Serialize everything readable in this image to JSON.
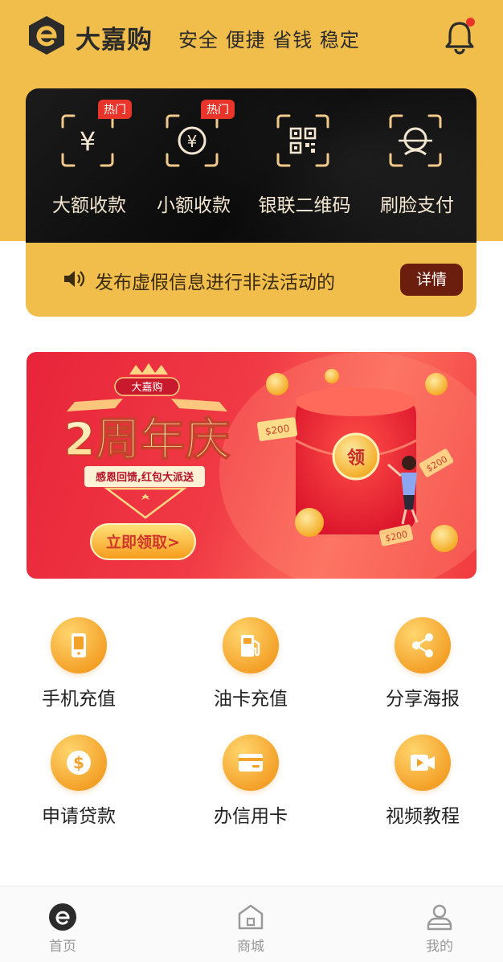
{
  "header": {
    "brand": "大嘉购",
    "slogan": "安全 便捷 省钱 稳定",
    "notification_icon": "bell-icon"
  },
  "colors": {
    "primary_yellow": "#f2be4b",
    "dark_card": "#111111",
    "hot_badge": "#e8352b",
    "detail_button": "#6b1d0e",
    "icon_orange": "#f4a22a"
  },
  "payments": [
    {
      "label": "大额收款",
      "badge": "热门",
      "icon": "yuan-scan-icon"
    },
    {
      "label": "小额收款",
      "badge": "热门",
      "icon": "yuan-coin-scan-icon"
    },
    {
      "label": "银联二维码",
      "badge": "",
      "icon": "qr-code-scan-icon"
    },
    {
      "label": "刷脸支付",
      "badge": "",
      "icon": "face-scan-icon"
    }
  ],
  "notice": {
    "icon": "speaker-icon",
    "text": "发布虚假信息进行非法活动的",
    "detail_label": "详情"
  },
  "banner": {
    "brand_tag": "大嘉购",
    "title": "2周年庆",
    "subtitle": "感恩回馈,红包大派送",
    "button": "立即领取>",
    "envelope_char": "领",
    "coin_amount": "$200",
    "coin_amount_2": "$200",
    "coin_amount_3": "$200"
  },
  "services": [
    {
      "label": "手机充值",
      "icon": "phone-icon"
    },
    {
      "label": "油卡充值",
      "icon": "fuel-pump-icon"
    },
    {
      "label": "分享海报",
      "icon": "share-icon"
    },
    {
      "label": "申请贷款",
      "icon": "dollar-coin-icon"
    },
    {
      "label": "办信用卡",
      "icon": "credit-card-icon"
    },
    {
      "label": "视频教程",
      "icon": "video-play-icon"
    }
  ],
  "tabbar": [
    {
      "label": "首页",
      "icon": "home-logo-icon",
      "active": true
    },
    {
      "label": "商城",
      "icon": "shop-icon",
      "active": false
    },
    {
      "label": "我的",
      "icon": "profile-icon",
      "active": false
    }
  ]
}
